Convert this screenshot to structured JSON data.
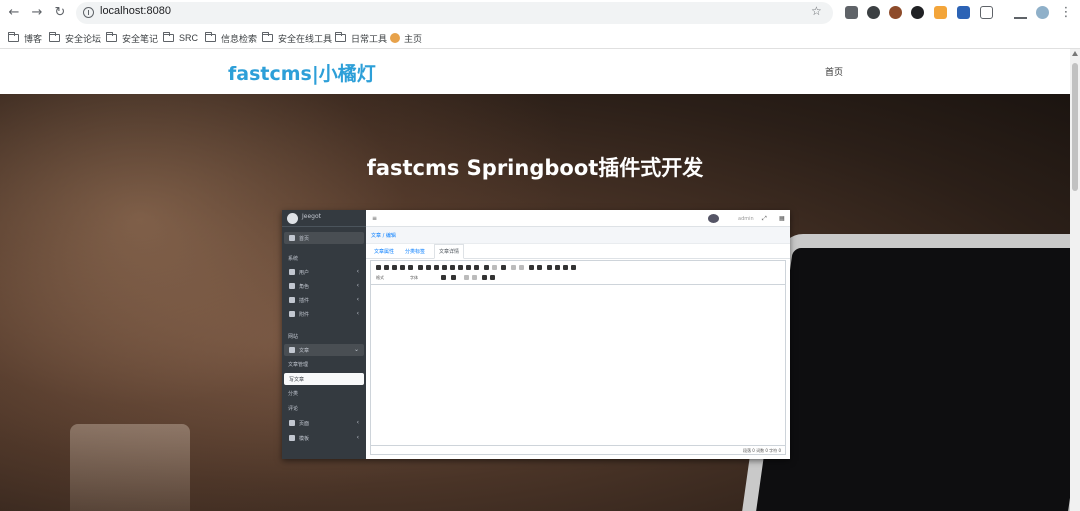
{
  "browser": {
    "url": "localhost:8080",
    "bookmarks": [
      "博客",
      "安全论坛",
      "安全笔记",
      "SRC",
      "信息检索",
      "安全在线工具",
      "日常工具",
      "主页"
    ]
  },
  "site": {
    "logo": "fastcms|小橘灯",
    "nav_home": "首页",
    "hero_title": "fastcms Springboot插件式开发",
    "accent_color": "#2d9fd8"
  },
  "admin_shot": {
    "brand": "Jeegot",
    "menu": [
      {
        "label": "首页"
      },
      {
        "label": "系统"
      },
      {
        "label": "用户"
      },
      {
        "label": "角色"
      },
      {
        "label": "插件"
      },
      {
        "label": "附件"
      },
      {
        "label": "网站"
      },
      {
        "label": "文章"
      },
      {
        "label": "文章管理"
      },
      {
        "label": "写文章"
      },
      {
        "label": "分类"
      },
      {
        "label": "评论"
      },
      {
        "label": "页面"
      },
      {
        "label": "模板"
      }
    ],
    "user": "admin",
    "breadcrumb": "文章 / 编辑",
    "tabs": [
      "文章属性",
      "分类标签",
      "文章详情"
    ],
    "editor_labels": [
      "格式",
      "字体"
    ],
    "status": "段落 0 词数 0 字符 0"
  }
}
